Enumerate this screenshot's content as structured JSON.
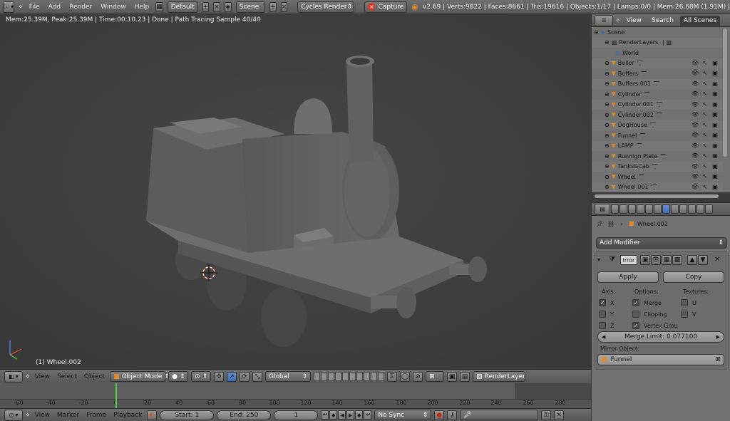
{
  "topbar": {
    "menus": [
      "File",
      "Add",
      "Render",
      "Window",
      "Help"
    ],
    "screen_layout": "Default",
    "scene": "Scene",
    "render_engine": "Cycles Render",
    "capture_label": "Capture",
    "stats": "v2.69 | Verts:9822 | Faces:8661 | Tris:19616 | Objects:1/17 | Lamps:0/0 | Mem:26.68M (1.91M) |"
  },
  "viewport": {
    "info": "Mem:25.39M, Peak:25.39M | Time:00:10.23 | Done | Path Tracing Sample 40/40",
    "active_object_label": "(1) Wheel.002",
    "header": {
      "menus": [
        "View",
        "Select",
        "Object"
      ],
      "mode": "Object Mode",
      "orientation": "Global",
      "render_layer": "RenderLayer"
    }
  },
  "timeline": {
    "ticks": [
      "-60",
      "-40",
      "-20",
      "0",
      "20",
      "40",
      "60",
      "80",
      "100",
      "120",
      "140",
      "160",
      "180",
      "200",
      "220",
      "240",
      "260",
      "280"
    ],
    "header": {
      "menus": [
        "View",
        "Marker",
        "Frame",
        "Playback"
      ],
      "start": "Start: 1",
      "end": "End: 250",
      "current": "1",
      "sync": "No Sync"
    }
  },
  "outliner": {
    "tabs": [
      "View",
      "Search",
      "All Scenes"
    ],
    "items": [
      {
        "label": "Scene",
        "kind": "scene"
      },
      {
        "label": "RenderLayers",
        "kind": "renderlayer"
      },
      {
        "label": "World",
        "kind": "world"
      },
      {
        "label": "Boiler",
        "kind": "object"
      },
      {
        "label": "Buffers",
        "kind": "object"
      },
      {
        "label": "Buffers.001",
        "kind": "object"
      },
      {
        "label": "Cylinder",
        "kind": "object"
      },
      {
        "label": "Cylinder.001",
        "kind": "object"
      },
      {
        "label": "Cylinder.002",
        "kind": "object"
      },
      {
        "label": "DogHouse",
        "kind": "object"
      },
      {
        "label": "Funnel",
        "kind": "object"
      },
      {
        "label": "LAMP",
        "kind": "object"
      },
      {
        "label": "Runnign Plate",
        "kind": "object"
      },
      {
        "label": "Tanks&Cab",
        "kind": "object"
      },
      {
        "label": "Wheel",
        "kind": "object"
      },
      {
        "label": "Wheel.001",
        "kind": "object"
      }
    ]
  },
  "properties": {
    "breadcrumb_object": "Wheel.002",
    "add_modifier": "Add Modifier",
    "modifier_name": "irror",
    "apply": "Apply",
    "copy": "Copy",
    "axis_label": "Axis:",
    "options_label": "Options:",
    "textures_label": "Textures:",
    "axes": [
      "X",
      "Y",
      "Z"
    ],
    "options": [
      "Merge",
      "Clipping",
      "Vertex Grou"
    ],
    "textures": [
      "U",
      "V"
    ],
    "merge_limit": "Merge Limit: 0.077100",
    "mirror_object_label": "Mirror Object:",
    "mirror_object": "Funnel"
  },
  "colors": {
    "frame_indicator": "#5ad04a",
    "object_icon": "#e08a2c",
    "active_tab": "#3d6bb8",
    "capture_icon": "#d83a2a"
  }
}
